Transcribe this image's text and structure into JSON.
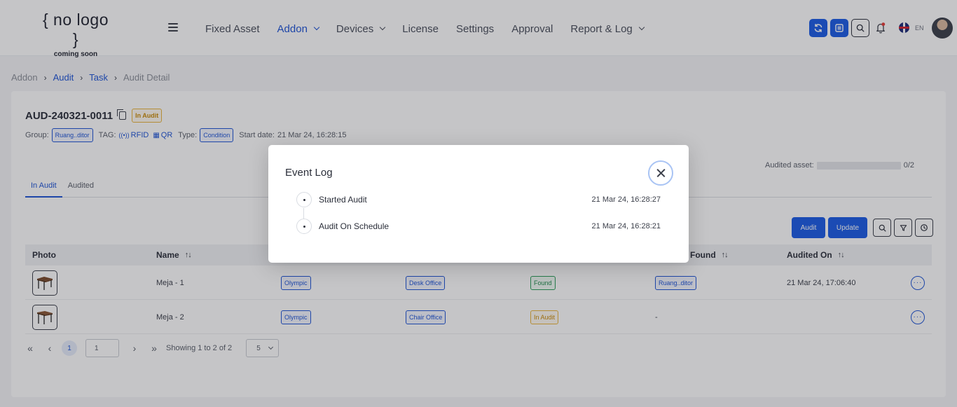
{
  "logo": {
    "line1": "{ no logo }",
    "line2": "coming soon"
  },
  "nav": [
    {
      "label": "Fixed Asset",
      "dropdown": false,
      "active": false
    },
    {
      "label": "Addon",
      "dropdown": true,
      "active": true
    },
    {
      "label": "Devices",
      "dropdown": true,
      "active": false
    },
    {
      "label": "License",
      "dropdown": false,
      "active": false
    },
    {
      "label": "Settings",
      "dropdown": false,
      "active": false
    },
    {
      "label": "Approval",
      "dropdown": false,
      "active": false
    },
    {
      "label": "Report & Log",
      "dropdown": true,
      "active": false
    }
  ],
  "header_icons": [
    "sync-icon",
    "list-icon",
    "search-icon",
    "bell-icon"
  ],
  "language": "EN",
  "breadcrumb": [
    "Addon",
    "Audit",
    "Task",
    "Audit Detail"
  ],
  "audit": {
    "id": "AUD-240321-0011",
    "status": "In Audit",
    "group_label": "Group:",
    "group_value": "Ruang..ditor",
    "tag_label": "TAG:",
    "tag_rfid": "RFID",
    "tag_qr": "QR",
    "type_label": "Type:",
    "type_value": "Condition",
    "start_label": "Start date:",
    "start_value": "21 Mar 24, 16:28:15",
    "audited_asset_label": "Audited asset:",
    "audited_asset_count": "0/2",
    "audited_asset_progress": 0
  },
  "tabs": [
    "In Audit",
    "Audited"
  ],
  "buttons": {
    "audit": "Audit",
    "update": "Update"
  },
  "table": {
    "headers": {
      "photo": "Photo",
      "name": "Name",
      "found": "Found",
      "audited_on": "Audited On"
    },
    "rows": [
      {
        "name": "Meja - 1",
        "brand": "Olympic",
        "category": "Desk Office",
        "status": "Found",
        "location": "Ruang..ditor",
        "audited_on": "21 Mar 24, 17:06:40"
      },
      {
        "name": "Meja - 2",
        "brand": "Olympic",
        "category": "Chair Office",
        "status": "In Audit",
        "location": "-",
        "audited_on": ""
      }
    ]
  },
  "pagination": {
    "current_page": "1",
    "page_input": "1",
    "showing": "Showing 1 to 2 of 2",
    "page_size": "5"
  },
  "modal": {
    "title": "Event Log",
    "events": [
      {
        "name": "Started Audit",
        "time": "21 Mar 24, 16:28:27"
      },
      {
        "name": "Audit On Schedule",
        "time": "21 Mar 24, 16:28:21"
      }
    ]
  },
  "colors": {
    "primary": "#1a5be6",
    "found": "#2a9d5a",
    "in_audit": "#e8b43c"
  }
}
